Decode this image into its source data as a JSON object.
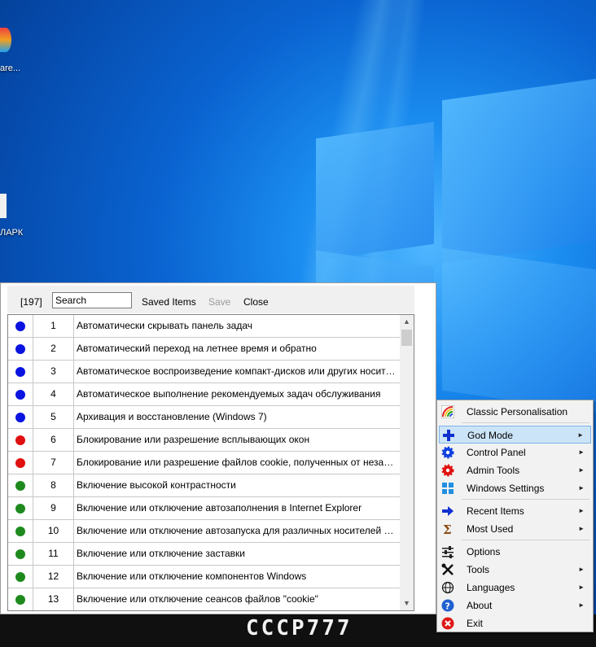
{
  "desktop": {
    "icon1_label": "are...",
    "icon2_label": "ЛАРК"
  },
  "taskbar": {
    "brand": "CCCP777"
  },
  "list_window": {
    "count": "[197]",
    "search_placeholder": "Search",
    "saved_items": "Saved Items",
    "save": "Save",
    "close": "Close",
    "rows": [
      {
        "n": "1",
        "color": "#0a14e0",
        "name": "Автоматически скрывать панель задач"
      },
      {
        "n": "2",
        "color": "#0a14e0",
        "name": "Автоматический переход на летнее время и обратно"
      },
      {
        "n": "3",
        "color": "#0a14e0",
        "name": "Автоматическое воспроизведение компакт-дисков или других носителей"
      },
      {
        "n": "4",
        "color": "#0a14e0",
        "name": "Автоматическое выполнение рекомендуемых задач обслуживания"
      },
      {
        "n": "5",
        "color": "#0a14e0",
        "name": "Архивация и восстановление (Windows 7)"
      },
      {
        "n": "6",
        "color": "#e01010",
        "name": "Блокирование или разрешение всплывающих окон"
      },
      {
        "n": "7",
        "color": "#e01010",
        "name": "Блокирование или разрешение файлов cookie, полученных от независимых сайтов"
      },
      {
        "n": "8",
        "color": "#1e8a1e",
        "name": "Включение высокой контрастности"
      },
      {
        "n": "9",
        "color": "#1e8a1e",
        "name": "Включение или отключение автозаполнения в Internet Explorer"
      },
      {
        "n": "10",
        "color": "#1e8a1e",
        "name": "Включение или отключение автозапуска для различных носителей и устройств"
      },
      {
        "n": "11",
        "color": "#1e8a1e",
        "name": "Включение или отключение заставки"
      },
      {
        "n": "12",
        "color": "#1e8a1e",
        "name": "Включение или отключение компонентов Windows"
      },
      {
        "n": "13",
        "color": "#1e8a1e",
        "name": "Включение или отключение сеансов файлов \"cookie\""
      }
    ]
  },
  "menu": {
    "items": [
      {
        "label": "Classic Personalisation",
        "icon": "rainbow-icon",
        "arrow": ""
      },
      {
        "label": "God Mode",
        "icon": "plus-icon",
        "arrow": "►"
      },
      {
        "label": "Control Panel",
        "icon": "blue-gear-icon",
        "arrow": "►"
      },
      {
        "label": "Admin Tools",
        "icon": "red-gear-icon",
        "arrow": "►"
      },
      {
        "label": "Windows Settings",
        "icon": "windows-logo-icon",
        "arrow": "►"
      },
      {
        "label": "Recent Items",
        "icon": "arrow-right-icon",
        "arrow": "►"
      },
      {
        "label": "Most Used",
        "icon": "sigma-icon",
        "arrow": "►"
      },
      {
        "label": "Options",
        "icon": "sliders-icon",
        "arrow": ""
      },
      {
        "label": "Tools",
        "icon": "tools-icon",
        "arrow": "►"
      },
      {
        "label": "Languages",
        "icon": "globe-icon",
        "arrow": "►"
      },
      {
        "label": "About",
        "icon": "help-icon",
        "arrow": "►"
      },
      {
        "label": "Exit",
        "icon": "exit-icon",
        "arrow": ""
      }
    ]
  }
}
